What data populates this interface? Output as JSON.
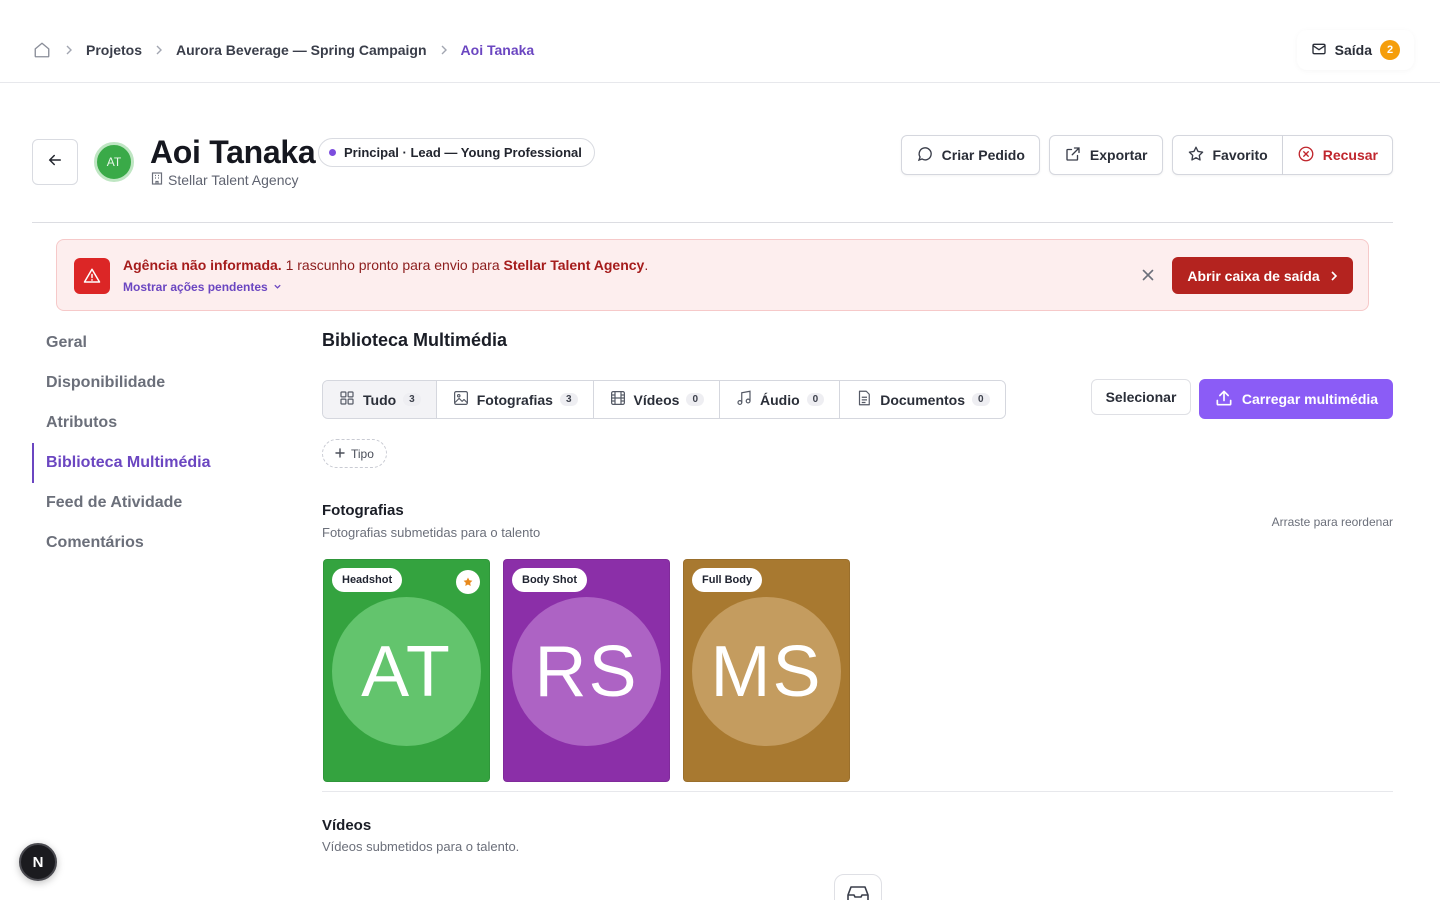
{
  "breadcrumb": {
    "items": [
      "Projetos",
      "Aurora Beverage — Spring Campaign",
      "Aoi Tanaka"
    ]
  },
  "outbox": {
    "label": "Saída",
    "count": "2"
  },
  "talent": {
    "initials": "AT",
    "name": "Aoi Tanaka",
    "role": "Principal · Lead — Young Professional",
    "agency": "Stellar Talent Agency"
  },
  "actions": {
    "create_order": "Criar Pedido",
    "export": "Exportar",
    "favorite": "Favorito",
    "decline": "Recusar"
  },
  "alert": {
    "title": "Agência não informada.",
    "text_before": " 1 rascunho pronto para envio para ",
    "agency": "Stellar Talent Agency",
    "text_after": ".",
    "pending_link": "Mostrar ações pendentes",
    "open_outbox": "Abrir caixa de saída"
  },
  "sidebar": {
    "items": [
      {
        "label": "Geral"
      },
      {
        "label": "Disponibilidade"
      },
      {
        "label": "Atributos"
      },
      {
        "label": "Biblioteca Multimédia",
        "active": true
      },
      {
        "label": "Feed de Atividade"
      },
      {
        "label": "Comentários"
      }
    ]
  },
  "media": {
    "title": "Biblioteca Multimédia",
    "tabs": [
      {
        "label": "Tudo",
        "count": "3",
        "icon": "grid-icon"
      },
      {
        "label": "Fotografias",
        "count": "3",
        "icon": "image-icon"
      },
      {
        "label": "Vídeos",
        "count": "0",
        "icon": "film-icon"
      },
      {
        "label": "Áudio",
        "count": "0",
        "icon": "music-icon"
      },
      {
        "label": "Documentos",
        "count": "0",
        "icon": "document-icon"
      }
    ],
    "select_label": "Selecionar",
    "upload_label": "Carregar multimédia",
    "type_filter": "Tipo",
    "photos": {
      "title": "Fotografias",
      "subtitle": "Fotografias submetidas para o talento",
      "reorder_hint": "Arraste para reordenar",
      "items": [
        {
          "tag": "Headshot",
          "initials": "AT",
          "bg": "#34a33f",
          "circle": "#63c46d",
          "favorite": true
        },
        {
          "tag": "Body Shot",
          "initials": "RS",
          "bg": "#8b2fa8",
          "circle": "#ad63c4",
          "favorite": false
        },
        {
          "tag": "Full Body",
          "initials": "MS",
          "bg": "#a87930",
          "circle": "#c49c5f",
          "favorite": false
        }
      ]
    },
    "videos": {
      "title": "Vídeos",
      "subtitle": "Vídeos submetidos para o talento."
    }
  },
  "dev_badge": "N",
  "colors": {
    "accent": "#6b46c1",
    "primary_button": "#8b5cf6",
    "danger": "#b4231f",
    "alert_bg": "#fdeeee"
  }
}
